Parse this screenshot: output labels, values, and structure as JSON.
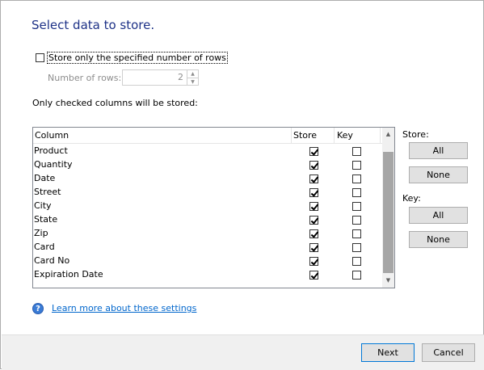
{
  "title": "Select data to store.",
  "store_rows": {
    "label": "Store only the specified number of rows",
    "checked": false,
    "num_rows_label": "Number of rows:",
    "num_rows_value": "2"
  },
  "only_checked_label": "Only checked columns will be stored:",
  "grid": {
    "headers": {
      "column": "Column",
      "store": "Store",
      "key": "Key"
    },
    "rows": [
      {
        "name": "Product",
        "store": true,
        "key": false
      },
      {
        "name": "Quantity",
        "store": true,
        "key": false
      },
      {
        "name": "Date",
        "store": true,
        "key": false
      },
      {
        "name": "Street",
        "store": true,
        "key": false
      },
      {
        "name": "City",
        "store": true,
        "key": false
      },
      {
        "name": "State",
        "store": true,
        "key": false
      },
      {
        "name": "Zip",
        "store": true,
        "key": false
      },
      {
        "name": "Card",
        "store": true,
        "key": false
      },
      {
        "name": "Card No",
        "store": true,
        "key": false
      },
      {
        "name": "Expiration Date",
        "store": true,
        "key": false
      }
    ]
  },
  "store_panel": {
    "label": "Store:",
    "all_label": "All",
    "none_label": "None"
  },
  "key_panel": {
    "label": "Key:",
    "all_label": "All",
    "none_label": "None"
  },
  "help": {
    "icon": "help-icon",
    "link_text": "Learn more about these settings"
  },
  "footer": {
    "next_label": "Next",
    "cancel_label": "Cancel"
  },
  "colors": {
    "title": "#1e3287",
    "link": "#0066cc",
    "accent": "#0078d7"
  }
}
